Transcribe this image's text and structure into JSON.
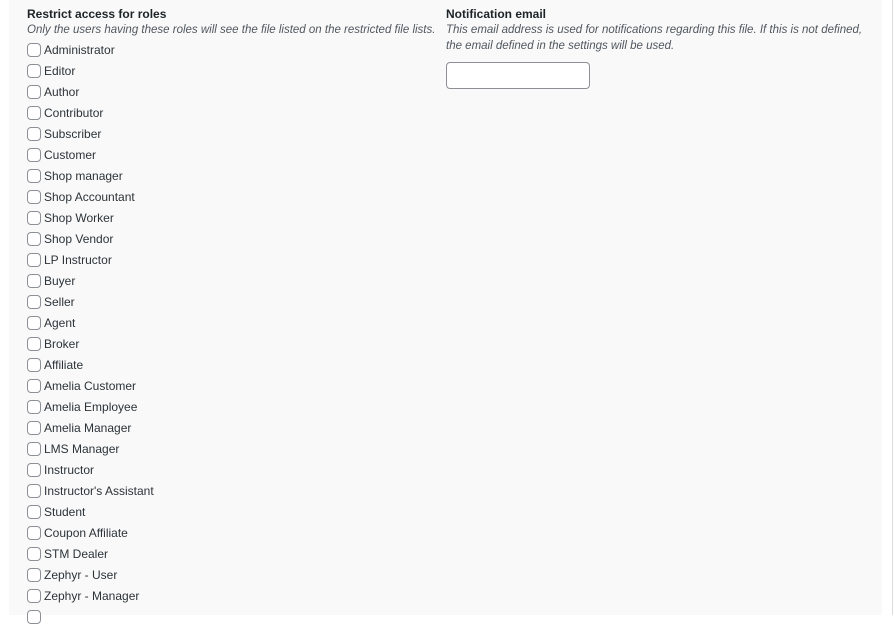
{
  "restrict_roles": {
    "title": "Restrict access for roles",
    "description": "Only the users having these roles will see the file listed on the restricted file lists.",
    "roles": [
      {
        "label": "Administrator",
        "checked": false
      },
      {
        "label": "Editor",
        "checked": false
      },
      {
        "label": "Author",
        "checked": false
      },
      {
        "label": "Contributor",
        "checked": false
      },
      {
        "label": "Subscriber",
        "checked": false
      },
      {
        "label": "Customer",
        "checked": false
      },
      {
        "label": "Shop manager",
        "checked": false
      },
      {
        "label": "Shop Accountant",
        "checked": false
      },
      {
        "label": "Shop Worker",
        "checked": false
      },
      {
        "label": "Shop Vendor",
        "checked": false
      },
      {
        "label": "LP Instructor",
        "checked": false
      },
      {
        "label": "Buyer",
        "checked": false
      },
      {
        "label": "Seller",
        "checked": false
      },
      {
        "label": "Agent",
        "checked": false
      },
      {
        "label": "Broker",
        "checked": false
      },
      {
        "label": "Affiliate",
        "checked": false
      },
      {
        "label": "Amelia Customer",
        "checked": false
      },
      {
        "label": "Amelia Employee",
        "checked": false
      },
      {
        "label": "Amelia Manager",
        "checked": false
      },
      {
        "label": "LMS Manager",
        "checked": false
      },
      {
        "label": "Instructor",
        "checked": false
      },
      {
        "label": "Instructor's Assistant",
        "checked": false
      },
      {
        "label": "Student",
        "checked": false
      },
      {
        "label": "Coupon Affiliate",
        "checked": false
      },
      {
        "label": "STM Dealer",
        "checked": false
      },
      {
        "label": "Zephyr - User",
        "checked": false
      },
      {
        "label": "Zephyr - Manager",
        "checked": false
      },
      {
        "label": "",
        "checked": false
      }
    ]
  },
  "notification_email": {
    "title": "Notification email",
    "description": "This email address is used for notifications regarding this file. If this is not defined, the email defined in the settings will be used.",
    "value": "",
    "placeholder": ""
  }
}
